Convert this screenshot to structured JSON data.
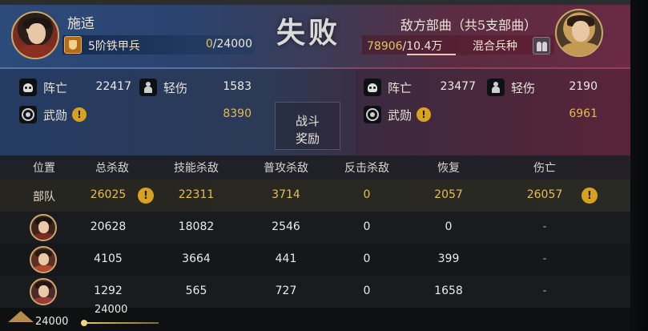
{
  "header": {
    "commander_name": "施适",
    "troop_name": "5阶铁甲兵",
    "troop_current": "0",
    "troop_total": "/24000",
    "result": "失败",
    "enemy_title": "敌方部曲（共5支部曲）",
    "enemy_current": "78906",
    "enemy_total": "/10.4万",
    "enemy_type": "混合兵种",
    "enemy_progress_fraction": 0.76
  },
  "stats": {
    "left": {
      "killed_label": "阵亡",
      "killed_value": "22417",
      "wounded_label": "轻伤",
      "wounded_value": "1583",
      "merit_label": "武勋",
      "merit_value": "8390"
    },
    "right": {
      "killed_label": "阵亡",
      "killed_value": "23477",
      "wounded_label": "轻伤",
      "wounded_value": "2190",
      "merit_label": "武勋",
      "merit_value": "6961"
    },
    "reward_line1": "战斗",
    "reward_line2": "奖励"
  },
  "table": {
    "headers": [
      "位置",
      "总杀敌",
      "技能杀敌",
      "普攻杀敌",
      "反击杀敌",
      "恢复",
      "伤亡"
    ],
    "total_row": {
      "label": "部队",
      "total_kills": "26025",
      "skill_kills": "22311",
      "normal_kills": "3714",
      "counter_kills": "0",
      "recover": "2057",
      "casualties": "26057"
    },
    "rows": [
      {
        "total_kills": "20628",
        "skill_kills": "18082",
        "normal_kills": "2546",
        "counter_kills": "0",
        "recover": "0",
        "casualties": "-"
      },
      {
        "total_kills": "4105",
        "skill_kills": "3664",
        "normal_kills": "441",
        "counter_kills": "0",
        "recover": "399",
        "casualties": "-"
      },
      {
        "total_kills": "1292",
        "skill_kills": "565",
        "normal_kills": "727",
        "counter_kills": "0",
        "recover": "1658",
        "casualties": "-"
      }
    ]
  },
  "footer": {
    "left_value": "24000",
    "top_value": "24000"
  },
  "colors": {
    "gold": "#e6bf4d",
    "ally": "#2c4a7a",
    "enemy": "#6a2a42"
  },
  "icons": {
    "killed": "skull-icon",
    "wounded": "wounded-soldier-icon",
    "merit": "medal-icon",
    "warning": "warning-icon"
  }
}
